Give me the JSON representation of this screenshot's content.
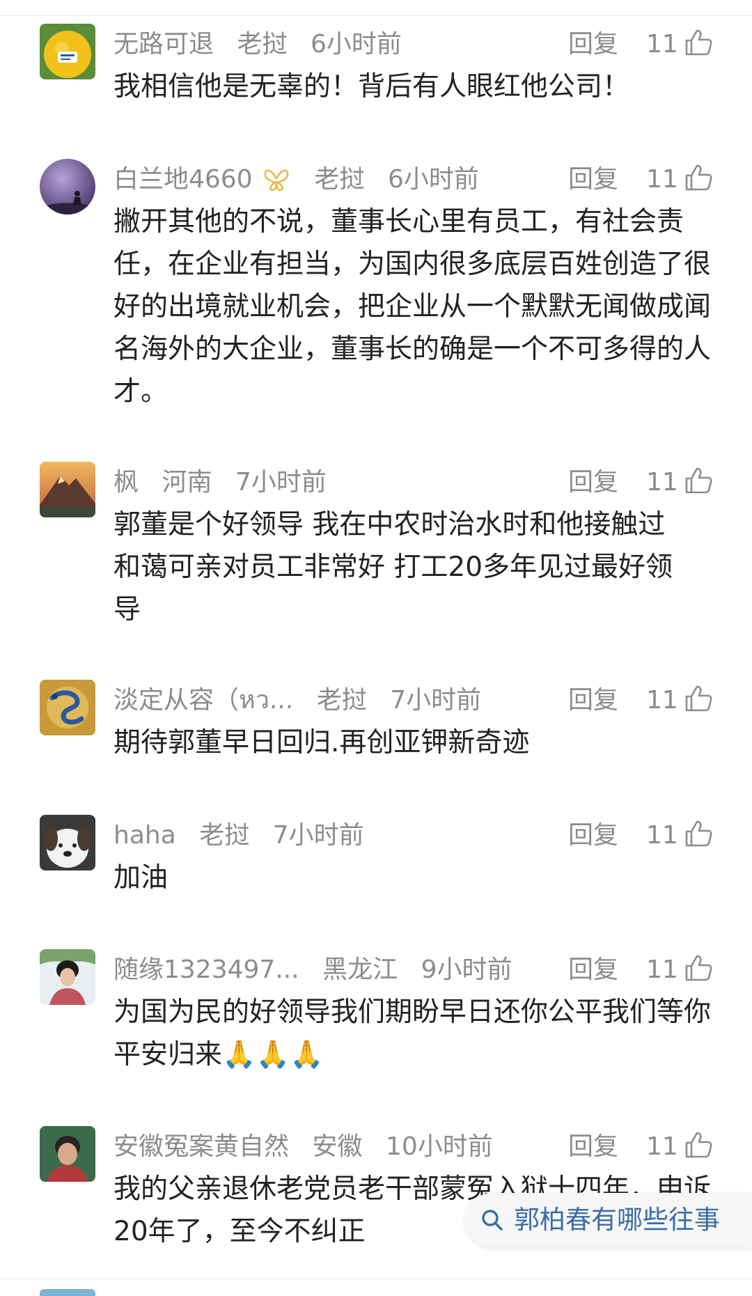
{
  "comments": [
    {
      "name": "无路可退",
      "location": "老挝",
      "time": "6小时前",
      "reply": "回复",
      "likes": "11",
      "text": "我相信他是无辜的！背后有人眼红他公司！",
      "avatar": "orange-fruit-avatar"
    },
    {
      "name": "白兰地4660",
      "location": "老挝",
      "time": "6小时前",
      "reply": "回复",
      "likes": "11",
      "text": "撇开其他的不说，董事长心里有员工，有社会责任，在企业有担当，为国内很多底层百姓创造了很好的出境就业机会，把企业从一个默默无闻做成闻名海外的大企业，董事长的确是一个不可多得的人才。",
      "avatar": "purple-silhouette-avatar",
      "badge": "butterfly-badge-icon"
    },
    {
      "name": "枫",
      "location": "河南",
      "time": "7小时前",
      "reply": "回复",
      "likes": "11",
      "text": "郭董是个好领导 我在中农时治水时和他接触过 和蔼可亲对员工非常好 打工20多年见过最好领导",
      "avatar": "mountain-sunset-avatar"
    },
    {
      "name": "淡定从容（หว...",
      "location": "老挝",
      "time": "7小时前",
      "reply": "回复",
      "likes": "11",
      "text": "期待郭董早日回归.再创亚钾新奇迹",
      "avatar": "blue-dragon-avatar"
    },
    {
      "name": "haha",
      "location": "老挝",
      "time": "7小时前",
      "reply": "回复",
      "likes": "11",
      "text": "加油",
      "avatar": "puppy-avatar"
    },
    {
      "name": "随缘1323497...",
      "location": "黑龙江",
      "time": "9小时前",
      "reply": "回复",
      "likes": "11",
      "text": "为国为民的好领导我们期盼早日还你公平我们等你平安归来🙏🙏🙏",
      "avatar": "woman-portrait-avatar"
    },
    {
      "name": "安徽冤案黄自然",
      "location": "安徽",
      "time": "10小时前",
      "reply": "回复",
      "likes": "11",
      "text": "我的父亲退休老党员老干部蒙冤入狱十四年，申诉20年了，至今不纠正",
      "avatar": "elderly-woman-avatar"
    }
  ],
  "search": {
    "label": "郭柏春有哪些往事"
  },
  "colors": {
    "meta_gray": "#8c8c8c",
    "link_blue": "#3a6ea5",
    "badge_gold": "#e8b94a"
  }
}
